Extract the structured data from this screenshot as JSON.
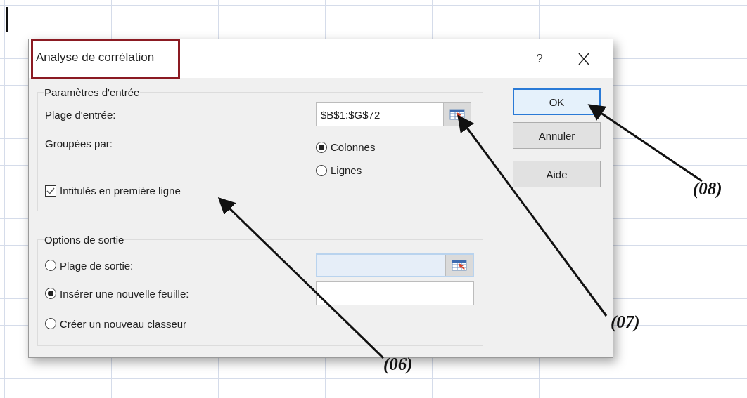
{
  "window": {
    "title": "Analyse de corrélation",
    "highlighted": true,
    "help": "?"
  },
  "input_group": {
    "legend": "Paramètres d'entrée",
    "input_range": {
      "label": "Plage d'entrée:",
      "value": "$B$1:$G$72"
    },
    "grouped_by": {
      "label": "Groupées par:",
      "options": [
        {
          "label": "Colonnes",
          "selected": true
        },
        {
          "label": "Lignes",
          "selected": false
        }
      ]
    },
    "headers_checkbox": {
      "label": "Intitulés en première ligne",
      "checked": true
    }
  },
  "output_group": {
    "legend": "Options de sortie",
    "options": [
      {
        "label": "Plage de sortie:",
        "selected": false,
        "kind": "range"
      },
      {
        "label": "Insérer une nouvelle feuille:",
        "selected": true,
        "kind": "text"
      },
      {
        "label": "Créer un nouveau classeur",
        "selected": false,
        "kind": "plain"
      }
    ]
  },
  "buttons": [
    {
      "label": "OK",
      "default": true
    },
    {
      "label": "Annuler",
      "default": false
    },
    {
      "label": "Aide",
      "default": false
    }
  ],
  "annotations": [
    {
      "label": "(08)"
    },
    {
      "label": "(07)"
    },
    {
      "label": "(06)"
    }
  ]
}
